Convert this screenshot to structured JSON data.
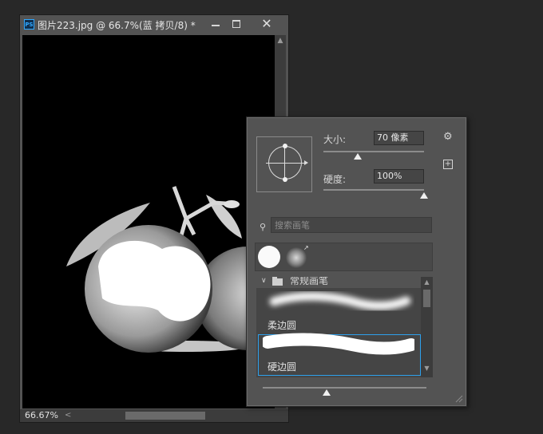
{
  "document": {
    "app_icon": "PS",
    "title": "图片223.jpg @ 66.7%(蓝 拷贝/8) *",
    "close_glyph": "✕",
    "zoom": "66.67%",
    "scroll_left_glyph": "<",
    "scroll_up_glyph": "▲"
  },
  "brush_panel": {
    "size_label": "大小:",
    "size_value": "70 像素",
    "hardness_label": "硬度:",
    "hardness_value": "100%",
    "size_slider_fraction": 0.34,
    "hardness_slider_fraction": 1.0,
    "spacing_slider_fraction": 0.39,
    "gear_glyph": "⚙",
    "new_preset_glyph": "+",
    "search_icon": "🔍",
    "search_placeholder": "搜索画笔",
    "group_chevron": "∨",
    "group_name": "常规画笔",
    "brushes": [
      {
        "name": "柔边圆",
        "type": "soft-round"
      },
      {
        "name": "硬边圆",
        "type": "hard-round",
        "selected": true
      }
    ],
    "list_up_glyph": "▲",
    "list_down_glyph": "▼",
    "accent_color": "#2ea0ec"
  }
}
